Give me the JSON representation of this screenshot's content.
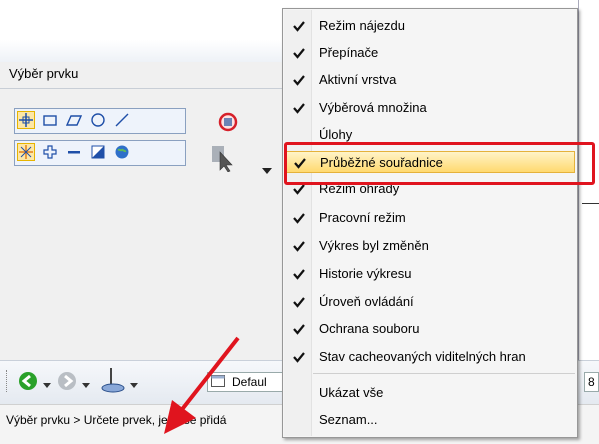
{
  "panel": {
    "title": "Výběr prvku"
  },
  "menu": {
    "items": [
      {
        "label": "Režim nájezdu",
        "checked": true
      },
      {
        "label": "Přepínače",
        "checked": true
      },
      {
        "label": "Aktivní vrstva",
        "checked": true
      },
      {
        "label": "Výběrová množina",
        "checked": true
      },
      {
        "label": "Úlohy",
        "checked": false
      },
      {
        "label": "Průběžné souřadnice",
        "checked": true,
        "highlighted": true
      },
      {
        "label": "Režim ohrady",
        "checked": true
      },
      {
        "label": "Pracovní režim",
        "checked": true
      },
      {
        "label": "Výkres byl změněn",
        "checked": true
      },
      {
        "label": "Historie výkresu",
        "checked": true
      },
      {
        "label": "Úroveň ovládání",
        "checked": true
      },
      {
        "label": "Ochrana souboru",
        "checked": true
      },
      {
        "label": "Stav cacheovaných viditelných hran",
        "checked": true
      }
    ],
    "show_all": "Ukázat vše",
    "list": "Seznam..."
  },
  "toolbar": {
    "default_label": "Defaul",
    "number_field": "8"
  },
  "status": {
    "text": "Výběr prvku > Určete prvek, jenž se přidá"
  },
  "colors": {
    "highlight": "#ffd970",
    "annotation_red": "#e0141e",
    "accent_blue": "#1f4fa8"
  }
}
